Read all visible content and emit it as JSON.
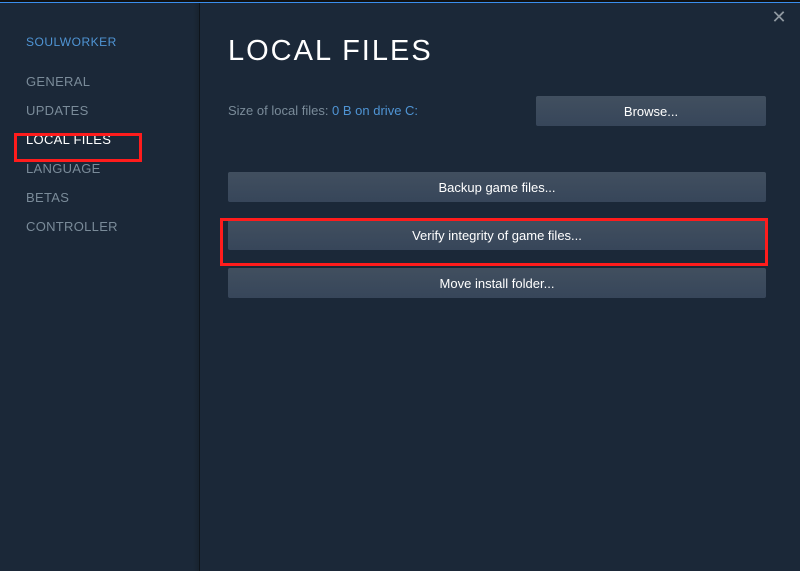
{
  "app_title": "SOULWORKER",
  "close_glyph": "✕",
  "sidebar": {
    "items": [
      {
        "label": "GENERAL"
      },
      {
        "label": "UPDATES"
      },
      {
        "label": "LOCAL FILES"
      },
      {
        "label": "LANGUAGE"
      },
      {
        "label": "BETAS"
      },
      {
        "label": "CONTROLLER"
      }
    ]
  },
  "content": {
    "title": "LOCAL FILES",
    "size_label": "Size of local files: ",
    "size_value": "0 B on drive C:",
    "browse_label": "Browse...",
    "backup_label": "Backup game files...",
    "verify_label": "Verify integrity of game files...",
    "move_label": "Move install folder..."
  }
}
